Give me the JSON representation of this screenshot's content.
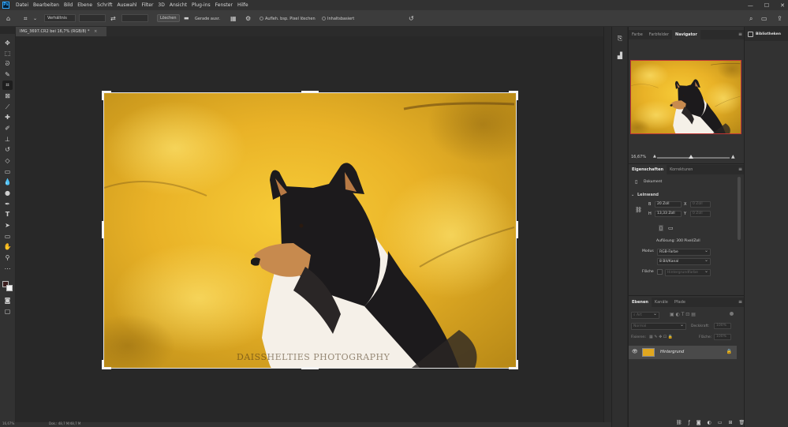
{
  "app": {
    "logo_text": "Ps",
    "menu": [
      "Datei",
      "Bearbeiten",
      "Bild",
      "Ebene",
      "Schrift",
      "Auswahl",
      "Filter",
      "3D",
      "Ansicht",
      "Plug-ins",
      "Fenster",
      "Hilfe"
    ],
    "window_controls": [
      "—",
      "☐",
      "✕"
    ]
  },
  "options_bar": {
    "ratio_select": "Verhältnis",
    "clear_button": "Löschen",
    "straighten_label": "Gerade ausr.",
    "delete_pixels_label": "Aufleh. bsp. Pixel löschen",
    "content_aware_label": "Inhaltsbasiert"
  },
  "document": {
    "tab_title": "IMG_3697.CR2 bei 16,7% (RGB/8) *",
    "watermark": "DAISSHELTIES PHOTOGRAPHY"
  },
  "status": {
    "zoom": "16,67%",
    "doc_info": "Dok.: 48,7 M/48,7 M"
  },
  "navigator": {
    "tabs": [
      "Farbe",
      "Farbfelder",
      "Navigator"
    ],
    "active_tab": "Navigator",
    "zoom": "16,67%",
    "zoom_level_fraction": 0.47
  },
  "properties": {
    "tabs": [
      "Eigenschaften",
      "Korrekturen"
    ],
    "active_tab": "Eigenschaften",
    "doc_label": "Dokument",
    "section": "Leinwand",
    "w_label": "B",
    "w_value": "20 Zoll",
    "h_label": "H",
    "h_value": "13,33 Zoll",
    "x_label": "X",
    "x_value": "0 Zoll",
    "y_label": "Y",
    "y_value": "0 Zoll",
    "resolution": "Auflösung: 300 Pixel/Zoll",
    "mode_label": "Modus",
    "mode_value": "RGB-Farbe",
    "depth_value": "8 Bit/Kanal",
    "fill_label": "Fläche",
    "fill_value": "Hintergrundfarbe"
  },
  "layers": {
    "tabs": [
      "Ebenen",
      "Kanäle",
      "Pfade"
    ],
    "active_tab": "Ebenen",
    "search_placeholder": "Art",
    "blend_mode": "Normal",
    "opacity_label": "Deckkraft:",
    "opacity_value": "100%",
    "lock_label": "Fixieren:",
    "fill_label": "Fläche:",
    "fill_value": "100%",
    "items": [
      {
        "name": "Hintergrund"
      }
    ]
  },
  "libraries": {
    "tab_label": "Bibliotheken"
  },
  "colors": {
    "accent_red": "#c23535",
    "photo_yellow": "#e0a71f"
  }
}
